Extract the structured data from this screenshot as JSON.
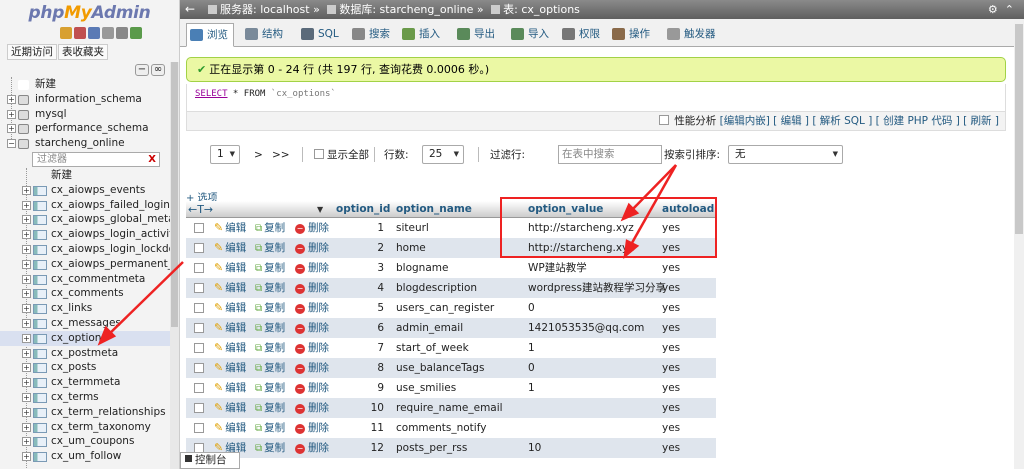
{
  "logo": {
    "php": "php",
    "my": "My",
    "admin": "Admin"
  },
  "nav": {
    "links": [
      "近期访问",
      "表收藏夹"
    ],
    "new_label": "新建",
    "databases": [
      "information_schema",
      "mysql",
      "performance_schema",
      "starcheng_online"
    ],
    "filter_placeholder": "过滤器",
    "filter_clear": "X",
    "table_new": "新建",
    "tables": [
      "cx_aiowps_events",
      "cx_aiowps_failed_logins",
      "cx_aiowps_global_meta",
      "cx_aiowps_login_activity",
      "cx_aiowps_login_lockdov",
      "cx_aiowps_permanent_bl",
      "cx_commentmeta",
      "cx_comments",
      "cx_links",
      "cx_messages",
      "cx_options",
      "cx_postmeta",
      "cx_posts",
      "cx_termmeta",
      "cx_terms",
      "cx_term_relationships",
      "cx_term_taxonomy",
      "cx_um_coupons",
      "cx_um_follow"
    ],
    "selected_table": "cx_options"
  },
  "breadcrumb": {
    "server": "服务器: localhost",
    "sep": "»",
    "database": "数据库: starcheng_online",
    "table": "表: cx_options"
  },
  "tabs": [
    {
      "label": "浏览",
      "icon": "browse-icon",
      "color": "#4a7fb5"
    },
    {
      "label": "结构",
      "icon": "structure-icon",
      "color": "#7a8a9a"
    },
    {
      "label": "SQL",
      "icon": "sql-icon",
      "color": "#5a6a7a"
    },
    {
      "label": "搜索",
      "icon": "search-icon",
      "color": "#888"
    },
    {
      "label": "插入",
      "icon": "insert-icon",
      "color": "#6a9a4a"
    },
    {
      "label": "导出",
      "icon": "export-icon",
      "color": "#5a8a5a"
    },
    {
      "label": "导入",
      "icon": "import-icon",
      "color": "#5a8a5a"
    },
    {
      "label": "权限",
      "icon": "privileges-icon",
      "color": "#777"
    },
    {
      "label": "操作",
      "icon": "operations-icon",
      "color": "#8a6a4a"
    },
    {
      "label": "触发器",
      "icon": "triggers-icon",
      "color": "#999"
    }
  ],
  "success_message": "正在显示第 0 - 24 行 (共 197 行, 查询花费 0.0006 秒。)",
  "sql": {
    "select": "SELECT",
    "rest": " * FROM ",
    "table": "`cx_options`"
  },
  "sql_ops": {
    "profiling": "性能分析",
    "links": "[编辑内嵌] [ 编辑 ] [ 解析 SQL ] [ 创建 PHP 代码 ] [ 刷新 ]"
  },
  "pager": {
    "page": "1",
    "next": ">",
    "last": ">>",
    "show_all": "显示全部",
    "rows_label": "行数:",
    "rows": "25",
    "filter_label": "过滤行:",
    "filter_placeholder": "在表中搜索",
    "sort_label": "按索引排序:",
    "sort_value": "无"
  },
  "options_link": "+ 选项",
  "columns": {
    "id": "option_id",
    "name": "option_name",
    "value": "option_value",
    "autoload": "autoload"
  },
  "actions": {
    "edit": "编辑",
    "copy": "复制",
    "delete": "删除"
  },
  "rows": [
    {
      "id": "1",
      "name": "siteurl",
      "value": "http://starcheng.xyz",
      "autoload": "yes"
    },
    {
      "id": "2",
      "name": "home",
      "value": "http://starcheng.xyz",
      "autoload": "yes"
    },
    {
      "id": "3",
      "name": "blogname",
      "value": "WP建站教学",
      "autoload": "yes"
    },
    {
      "id": "4",
      "name": "blogdescription",
      "value": "wordpress建站教程学习分享",
      "autoload": "yes"
    },
    {
      "id": "5",
      "name": "users_can_register",
      "value": "0",
      "autoload": "yes"
    },
    {
      "id": "6",
      "name": "admin_email",
      "value": "1421053535@qq.com",
      "autoload": "yes"
    },
    {
      "id": "7",
      "name": "start_of_week",
      "value": "1",
      "autoload": "yes"
    },
    {
      "id": "8",
      "name": "use_balanceTags",
      "value": "0",
      "autoload": "yes"
    },
    {
      "id": "9",
      "name": "use_smilies",
      "value": "1",
      "autoload": "yes"
    },
    {
      "id": "10",
      "name": "require_name_email",
      "value": "",
      "autoload": "yes"
    },
    {
      "id": "11",
      "name": "comments_notify",
      "value": "",
      "autoload": "yes"
    },
    {
      "id": "12",
      "name": "posts_per_rss",
      "value": "10",
      "autoload": "yes"
    }
  ],
  "console": "控制台"
}
